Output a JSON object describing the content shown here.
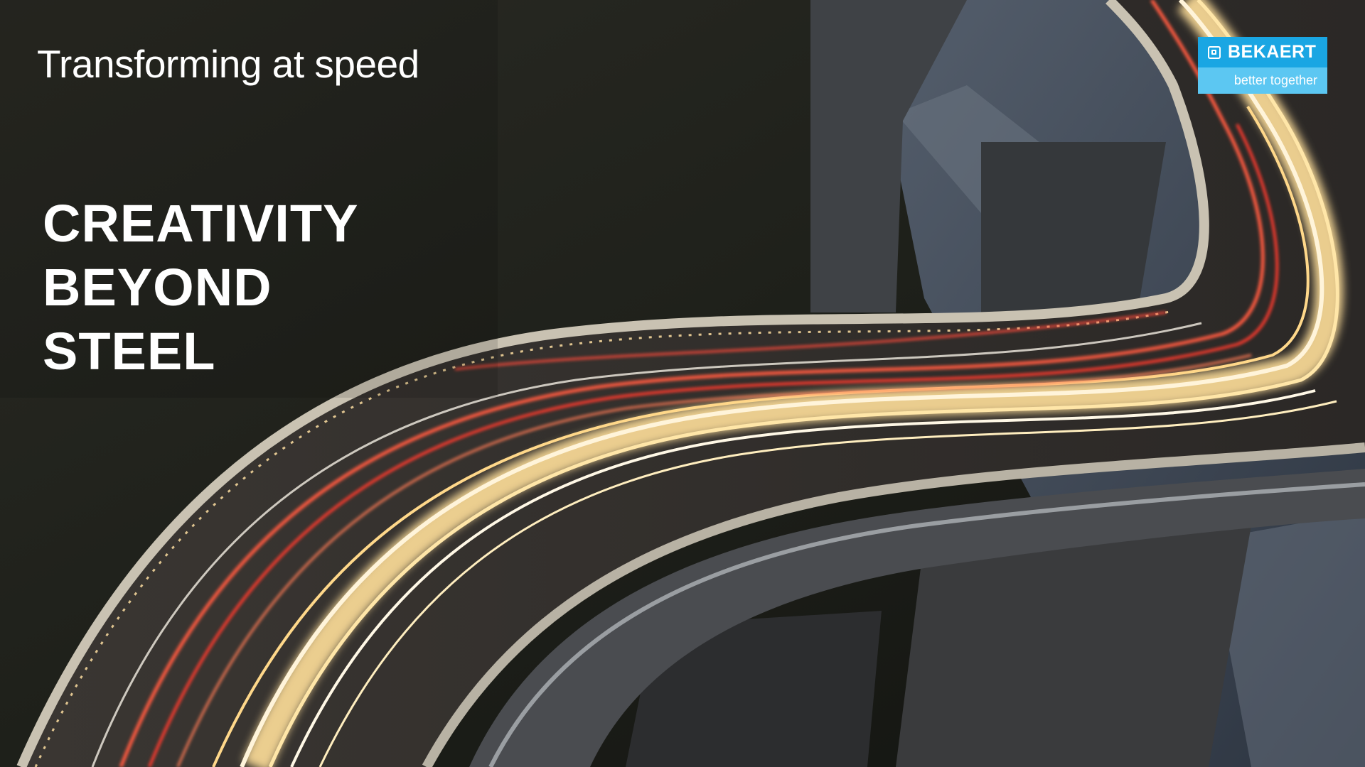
{
  "slide": {
    "subtitle": "Transforming at speed",
    "headline_lines": [
      "CREATIVITY",
      "BEYOND",
      "STEEL"
    ]
  },
  "logo": {
    "name": "BEKAERT",
    "tagline": "better together",
    "mark_icon": "bekaert-mark-icon"
  },
  "colors": {
    "logo_primary": "#1aa6e3",
    "logo_secondary": "#5cc7f2",
    "text": "#ffffff",
    "light_trail_warm": "#ffe7b0",
    "light_trail_red": "#ff4a3a"
  }
}
